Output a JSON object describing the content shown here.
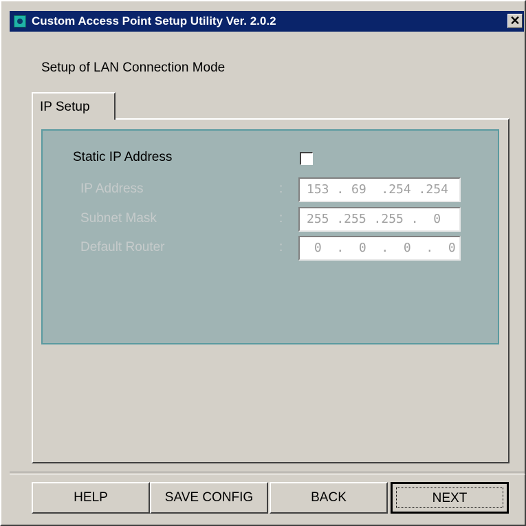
{
  "window": {
    "title": "Custom Access Point Setup Utility  Ver. 2.0.2",
    "close_symbol": "✕"
  },
  "section_heading": "Setup of LAN Connection Mode",
  "tabs": [
    {
      "label": "IP Setup",
      "selected": true
    }
  ],
  "ip_setup": {
    "static_ip_label": "Static IP Address",
    "static_ip_checked": false,
    "fields": [
      {
        "label": "IP Address",
        "separator": ":",
        "value": "153 . 69  .254 .254"
      },
      {
        "label": "Subnet Mask",
        "separator": ":",
        "value": "255 .255 .255 .  0"
      },
      {
        "label": "Default Router",
        "separator": ":",
        "value": " 0  .  0  .  0  .  0"
      }
    ]
  },
  "buttons": {
    "help": "HELP",
    "save_config": "SAVE CONFIG",
    "back": "BACK",
    "next": "NEXT"
  },
  "colors": {
    "titlebar": "#0a246a",
    "panel": "#a0b4b4",
    "face": "#d4d0c8",
    "disabled_text": "#c6cbcb"
  }
}
